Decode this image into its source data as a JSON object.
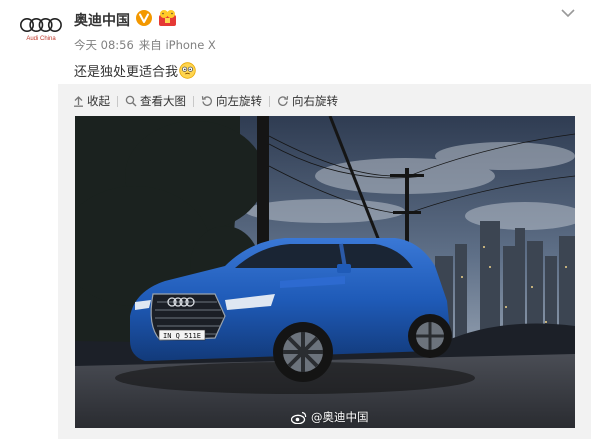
{
  "post": {
    "author": "奥迪中国",
    "avatar_subtitle": "Audi China",
    "time": "今天 08:56",
    "source": "来自 iPhone X",
    "text": "还是独处更适合我"
  },
  "toolbar": {
    "collapse": "收起",
    "view_large": "查看大图",
    "rotate_left": "向左旋转",
    "rotate_right": "向右旋转"
  },
  "image": {
    "license_plate": "IN Q 511E",
    "watermark": "@奥迪中国"
  },
  "icons": {
    "verified": "verified-v-icon",
    "badge": "emoji-badge-icon",
    "more": "chevron-down-icon",
    "content_emoji": "emoji-icon",
    "collapse": "collapse-up-icon",
    "zoom": "magnifier-icon",
    "rotate_left": "rotate-left-icon",
    "rotate_right": "rotate-right-icon",
    "weibo": "weibo-logo-icon"
  },
  "colors": {
    "brand_red": "#c0392b",
    "verified_orange": "#f39800",
    "car_blue": "#1f5bb8",
    "meta_gray": "#808080"
  }
}
